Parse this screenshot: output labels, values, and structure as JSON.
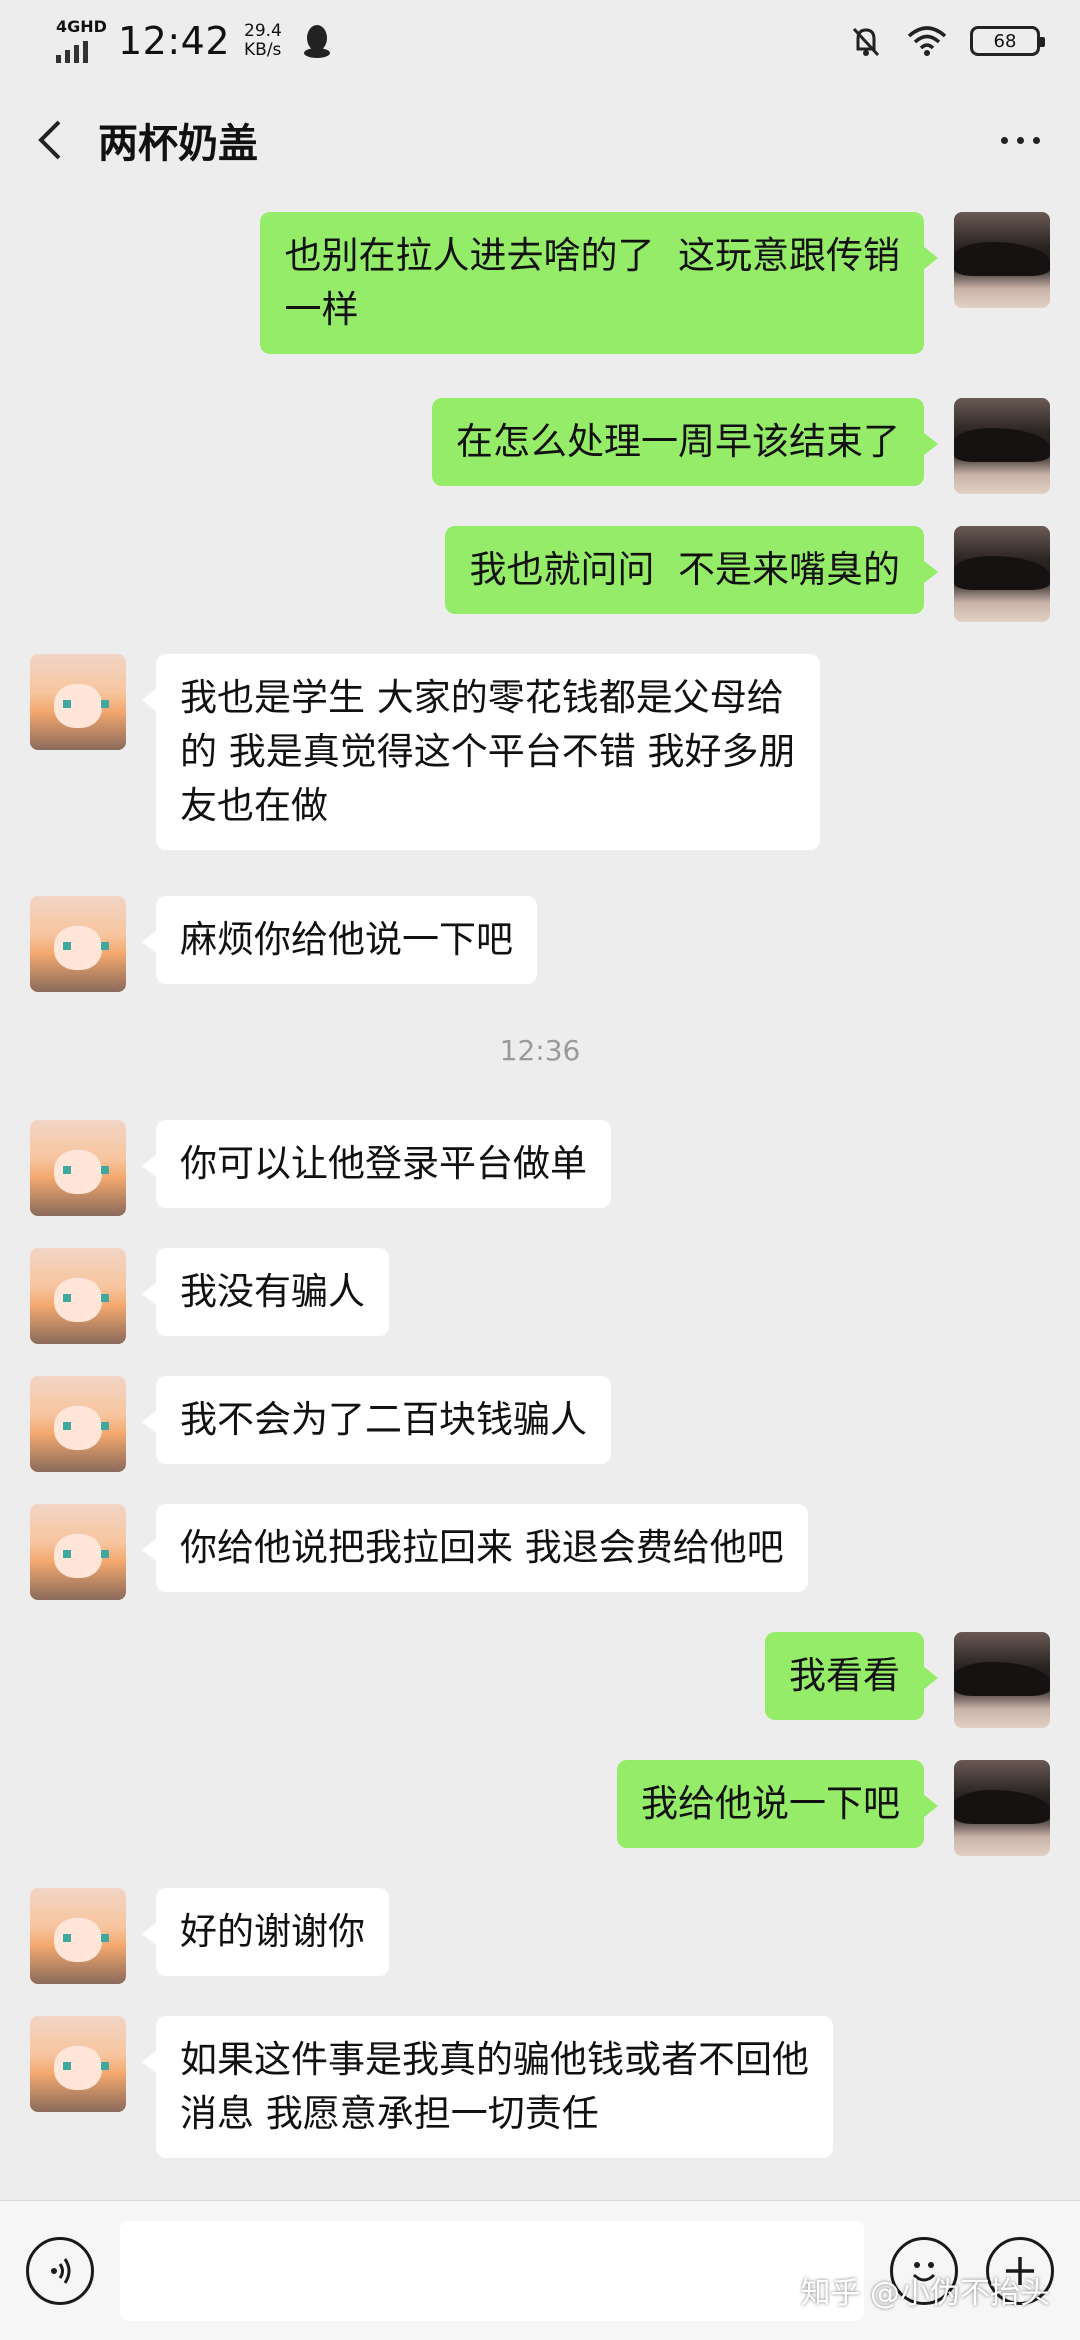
{
  "status_bar": {
    "network": "4GHD",
    "time": "12:42",
    "speed_value": "29.4",
    "speed_unit": "KB/s",
    "battery": "68",
    "icons": [
      "qq-icon",
      "mute-bell-icon",
      "wifi-icon",
      "battery-icon"
    ]
  },
  "header": {
    "title": "两杯奶盖",
    "back_icon": "chevron-left-icon",
    "more_icon": "more-dots-icon"
  },
  "colors": {
    "background": "#ededed",
    "my_bubble": "#95ec69",
    "other_bubble": "#ffffff",
    "timestamp": "#9a9a9a"
  },
  "messages": [
    {
      "from": "me",
      "lines": [
        "也别在拉人进去啥的了  这玩意跟传销",
        "一样"
      ]
    },
    {
      "from": "me",
      "lines": [
        "在怎么处理一周早该结束了"
      ]
    },
    {
      "from": "me",
      "lines": [
        "我也就问问  不是来嘴臭的"
      ]
    },
    {
      "from": "other",
      "lines": [
        "我也是学生 大家的零花钱都是父母给",
        "的 我是真觉得这个平台不错 我好多朋",
        "友也在做"
      ]
    },
    {
      "from": "other",
      "lines": [
        "麻烦你给他说一下吧"
      ]
    },
    {
      "from": "time",
      "lines": [
        "12:36"
      ]
    },
    {
      "from": "other",
      "lines": [
        "你可以让他登录平台做单"
      ]
    },
    {
      "from": "other",
      "lines": [
        "我没有骗人"
      ]
    },
    {
      "from": "other",
      "lines": [
        "我不会为了二百块钱骗人"
      ]
    },
    {
      "from": "other",
      "lines": [
        "你给他说把我拉回来 我退会费给他吧"
      ]
    },
    {
      "from": "me",
      "lines": [
        "我看看"
      ]
    },
    {
      "from": "me",
      "lines": [
        "我给他说一下吧"
      ]
    },
    {
      "from": "other",
      "lines": [
        "好的谢谢你"
      ]
    },
    {
      "from": "other",
      "lines": [
        "如果这件事是我真的骗他钱或者不回他",
        "消息 我愿意承担一切责任"
      ]
    }
  ],
  "input_bar": {
    "voice_icon": "voice-icon",
    "text_value": "",
    "emoji_icon": "emoji-icon",
    "plus_icon": "plus-icon"
  },
  "watermark": "知乎 @小伪不抬头"
}
